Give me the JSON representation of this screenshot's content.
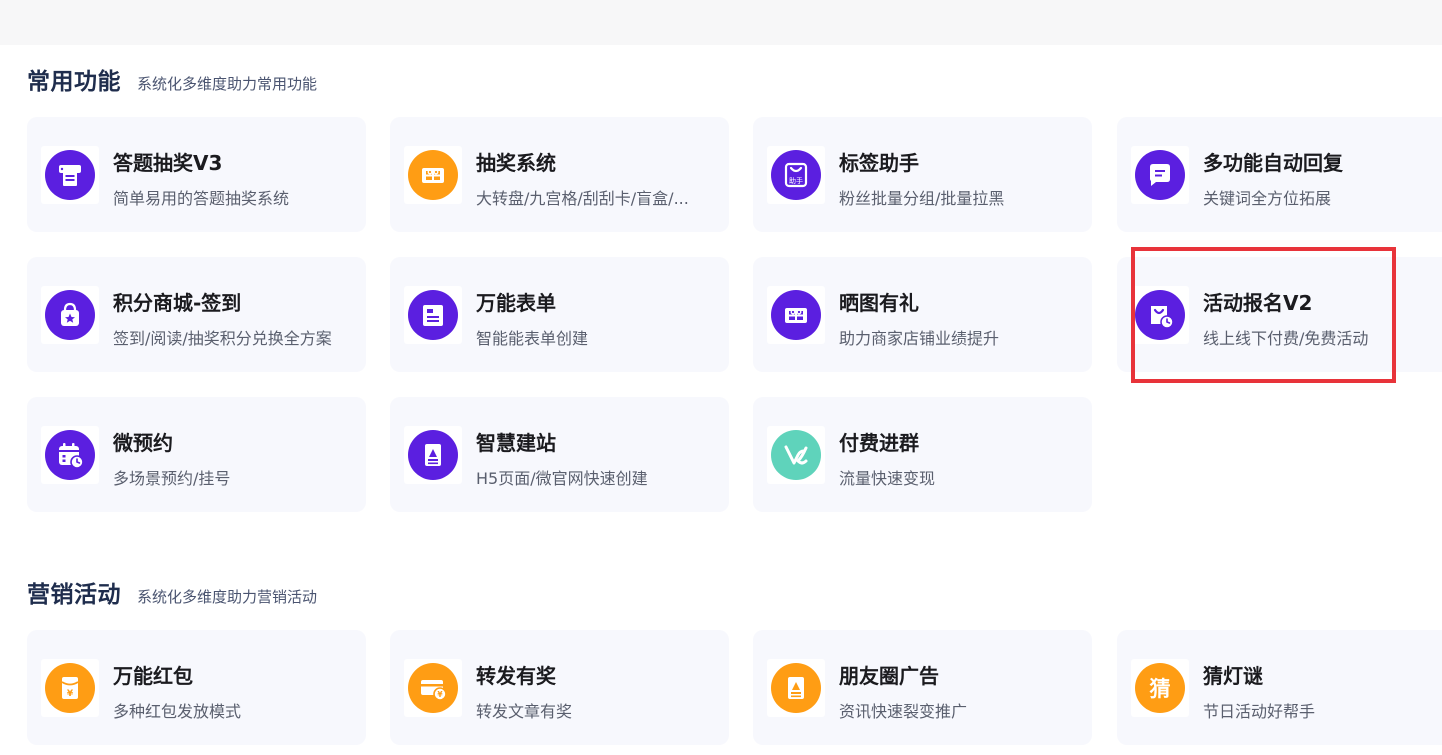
{
  "sections": [
    {
      "title": "常用功能",
      "subtitle": "系统化多维度助力常用功能",
      "items": [
        {
          "title": "答题抽奖V3",
          "desc": "简单易用的答题抽奖系统",
          "icon": "printer-form-icon",
          "color": "#5b1fe0"
        },
        {
          "title": "抽奖系统",
          "desc": "大转盘/九宫格/刮刮卡/盲盒/...",
          "icon": "gift-ticket-icon",
          "color": "#ff9d14"
        },
        {
          "title": "标签助手",
          "desc": "粉丝批量分组/批量拉黑",
          "icon": "bag-helper-icon",
          "color": "#5b1fe0",
          "icon_text": "助手"
        },
        {
          "title": "多功能自动回复",
          "desc": "关键词全方位拓展",
          "icon": "chat-bubble-icon",
          "color": "#5b1fe0"
        },
        {
          "title": "积分商城-签到",
          "desc": "签到/阅读/抽奖积分兑换全方案",
          "icon": "shopping-bag-star-icon",
          "color": "#5b1fe0"
        },
        {
          "title": "万能表单",
          "desc": "智能能表单创建",
          "icon": "form-document-icon",
          "color": "#5b1fe0"
        },
        {
          "title": "晒图有礼",
          "desc": "助力商家店铺业绩提升",
          "icon": "gift-ticket-icon",
          "color": "#5b1fe0"
        },
        {
          "title": "活动报名V2",
          "desc": "线上线下付费/免费活动",
          "icon": "bag-clock-icon",
          "color": "#5b1fe0"
        },
        {
          "title": "微预约",
          "desc": "多场景预约/挂号",
          "icon": "calendar-clock-icon",
          "color": "#5b1fe0"
        },
        {
          "title": "智慧建站",
          "desc": "H5页面/微官网快速创建",
          "icon": "page-builder-icon",
          "color": "#5b1fe0"
        },
        {
          "title": "付费进群",
          "desc": "流量快速变现",
          "icon": "group-link-icon",
          "color": "#5fd3bb"
        }
      ]
    },
    {
      "title": "营销活动",
      "subtitle": "系统化多维度助力营销活动",
      "items": [
        {
          "title": "万能红包",
          "desc": "多种红包发放模式",
          "icon": "red-packet-icon",
          "color": "#ff9d14"
        },
        {
          "title": "转发有奖",
          "desc": "转发文章有奖",
          "icon": "card-yuan-icon",
          "color": "#ff9d14"
        },
        {
          "title": "朋友圈广告",
          "desc": "资讯快速裂变推广",
          "icon": "page-builder-icon",
          "color": "#ff9d14"
        },
        {
          "title": "猜灯谜",
          "desc": "节日活动好帮手",
          "icon": "guess-character-icon",
          "color": "#ff9d14",
          "icon_text": "猜"
        }
      ]
    }
  ]
}
